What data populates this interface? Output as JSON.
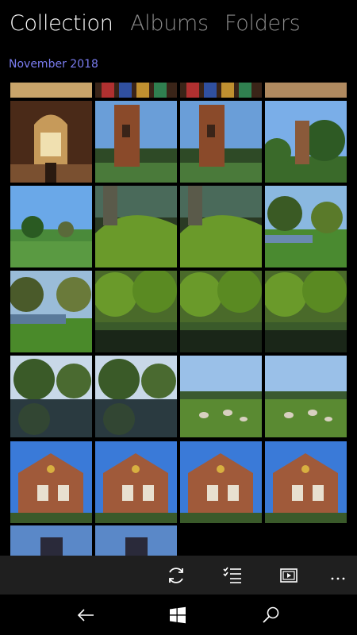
{
  "pivot": {
    "tabs": [
      {
        "label": "Collection",
        "active": true
      },
      {
        "label": "Albums",
        "active": false
      },
      {
        "label": "Folders",
        "active": false
      }
    ]
  },
  "gallery": {
    "group_header": "November 2018",
    "accent_color": "#7a7cf0",
    "rows": [
      [
        "church-interior-top",
        "stained-glass",
        "stained-glass",
        "church-roof"
      ],
      [
        "church-interior",
        "church-tower",
        "church-tower",
        "church-tower-trees"
      ],
      [
        "park-lawn",
        "mossy-tree-roots",
        "mossy-tree-roots",
        "park-pond-trees"
      ],
      [
        "pond-trees",
        "canal-trees",
        "canal-trees",
        "canal-trees"
      ],
      [
        "lake-reflection",
        "lake-reflection",
        "field-with-sheep",
        "field-with-sheep"
      ],
      [
        "brick-house",
        "brick-house",
        "brick-house",
        "brick-house"
      ],
      [
        "church-tower-dusk",
        "church-tower-dusk"
      ]
    ]
  },
  "appbar": {
    "icons": [
      "sync-icon",
      "select-icon",
      "slideshow-icon",
      "more-icon"
    ]
  },
  "navbar": {
    "icons": [
      "back-icon",
      "windows-icon",
      "search-icon"
    ]
  }
}
